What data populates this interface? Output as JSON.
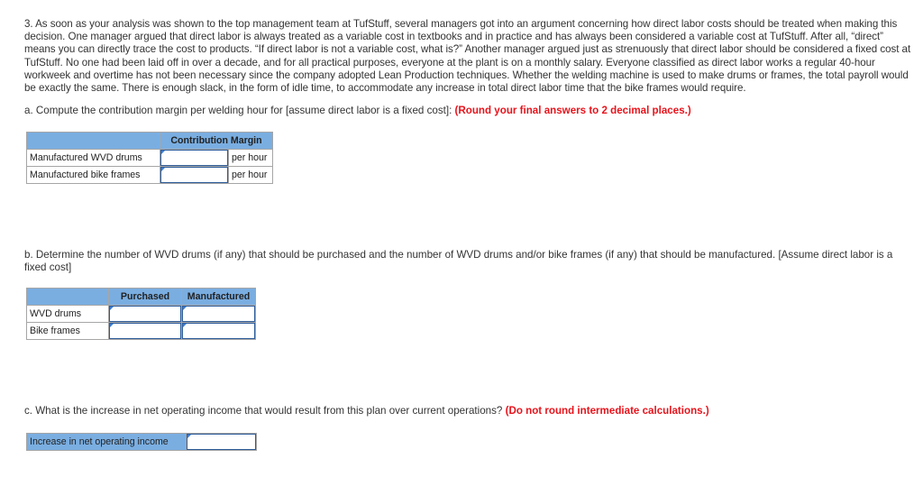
{
  "intro": {
    "text": "3. As soon as your analysis was shown to the top management team at TufStuff, several managers got into an argument concerning how direct labor costs should be treated when making this decision. One manager argued that direct labor is always treated as a variable cost in textbooks and in practice and has always been considered a variable cost at TufStuff. After all, “direct” means you can directly trace the cost to products. “If direct labor is not a variable cost, what is?” Another manager argued just as strenuously that direct labor should be considered a fixed cost at TufStuff. No one had been laid off in over a decade, and for all practical purposes, everyone at the plant is on a monthly salary. Everyone classified as direct labor works a regular 40-hour workweek and overtime has not been necessary since the company adopted Lean Production techniques. Whether the welding machine is used to make drums or frames, the total payroll would be exactly the same. There is enough slack, in the form of idle time, to accommodate any increase in total direct labor time that the bike frames would require."
  },
  "part_a": {
    "question": "a. Compute the contribution margin per welding hour for [assume direct labor is a fixed cost]: ",
    "instruction": "(Round your final answers to 2 decimal places.)",
    "table": {
      "header": "Contribution Margin",
      "rows": [
        {
          "label": "Manufactured WVD drums",
          "value": "",
          "unit": "per hour"
        },
        {
          "label": "Manufactured bike frames",
          "value": "",
          "unit": "per hour"
        }
      ]
    }
  },
  "part_b": {
    "question": "b. Determine the number of WVD drums (if any) that should be purchased and the number of WVD drums and/or bike frames (if any) that should be manufactured. [Assume direct labor is a fixed cost]",
    "table": {
      "headers": [
        "Purchased",
        "Manufactured"
      ],
      "rows": [
        {
          "label": "WVD drums",
          "purchased": "",
          "manufactured": ""
        },
        {
          "label": "Bike frames",
          "purchased": "",
          "manufactured": ""
        }
      ]
    }
  },
  "part_c": {
    "question": "c. What is the increase in net operating income that would result from this plan over current operations? ",
    "instruction": "(Do not round intermediate calculations.)",
    "table": {
      "label": "Increase in net operating income",
      "value": ""
    }
  },
  "colors": {
    "header_blue": "#7aaee1",
    "instruction_red": "#e8131b",
    "input_border": "#2d5c9a"
  }
}
